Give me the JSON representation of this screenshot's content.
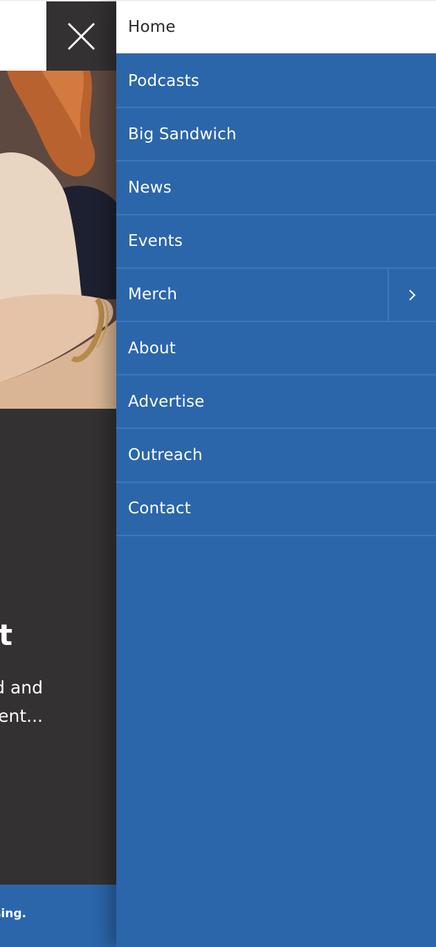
{
  "nav": {
    "items": [
      {
        "label": "Home",
        "active": true
      },
      {
        "label": "Podcasts"
      },
      {
        "label": "Big Sandwich"
      },
      {
        "label": "News"
      },
      {
        "label": "Events"
      },
      {
        "label": "Merch",
        "has_submenu": true,
        "submenu_icon": "chevron-right-icon"
      },
      {
        "label": "About"
      },
      {
        "label": "Advertise"
      },
      {
        "label": "Outreach"
      },
      {
        "label": "Contact"
      }
    ]
  },
  "page": {
    "close_icon": "close-icon",
    "card": {
      "title": "t",
      "excerpt_line_1": "d and",
      "excerpt_line_2": "ent..."
    },
    "footer_text": "sing."
  },
  "colors": {
    "nav_bg": "#2b66ab",
    "nav_divider": "#3a78bf",
    "dark_panel": "#333131",
    "active_item_bg": "#ffffff"
  }
}
